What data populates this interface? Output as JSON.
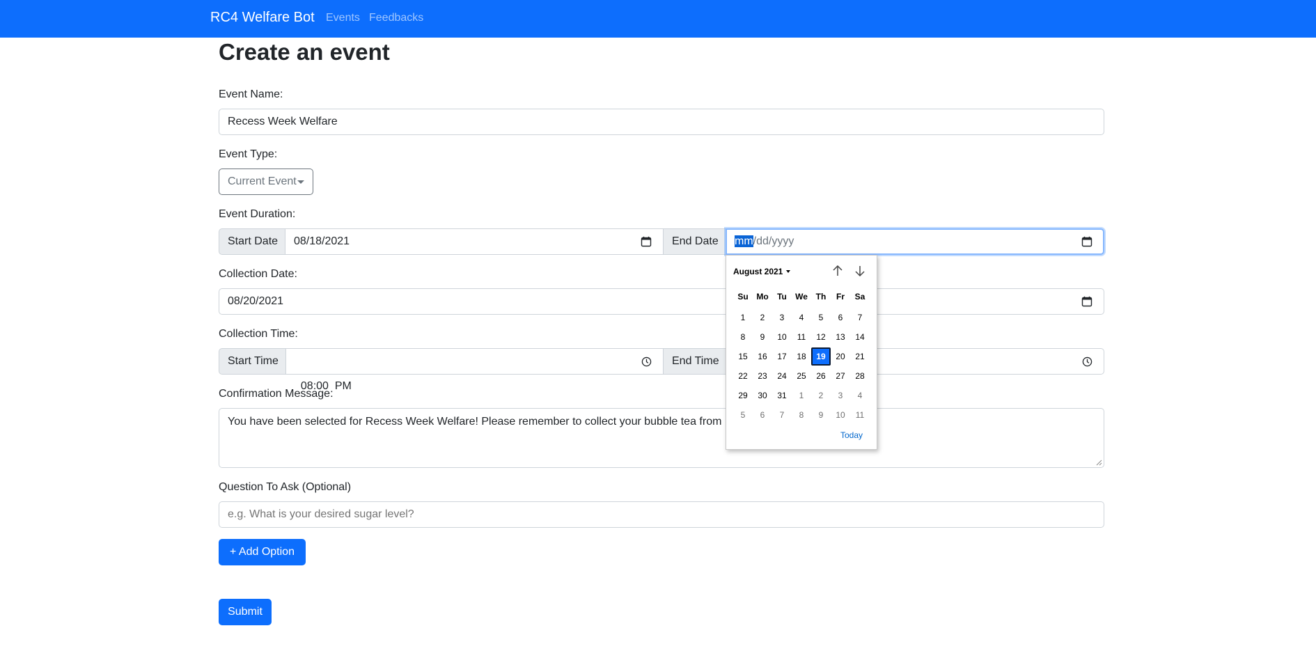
{
  "navbar": {
    "brand": "RC4 Welfare Bot",
    "links": [
      {
        "label": "Events"
      },
      {
        "label": "Feedbacks"
      }
    ]
  },
  "page_title": "Create an event",
  "form": {
    "event_name_label": "Event Name:",
    "event_name_value": "Recess Week Welfare",
    "event_type_label": "Event Type:",
    "event_type_value": "Current Event",
    "event_duration_label": "Event Duration:",
    "start_date_label": "Start Date",
    "start_date_value": "08/18/2021",
    "end_date_label": "End Date",
    "end_date_placeholder_mm": "mm",
    "end_date_placeholder_rest": "/dd/yyyy",
    "collection_date_label": "Collection Date:",
    "collection_date_value": "08/20/2021",
    "collection_time_label": "Collection Time:",
    "start_time_label": "Start Time",
    "start_time_value": "08:00  PM",
    "end_time_label": "End Time",
    "confirmation_label": "Confirmation Message:",
    "confirmation_value": "You have been selected for Recess Week Welfare! Please remember to collect your bubble tea from L8",
    "question_label": "Question To Ask (Optional)",
    "question_placeholder": "e.g. What is your desired sugar level?",
    "add_option_label": "+ Add Option",
    "submit_label": "Submit"
  },
  "datepicker": {
    "month_label": "August 2021",
    "weekdays": [
      "Su",
      "Mo",
      "Tu",
      "We",
      "Th",
      "Fr",
      "Sa"
    ],
    "weeks": [
      [
        {
          "d": "1"
        },
        {
          "d": "2"
        },
        {
          "d": "3"
        },
        {
          "d": "4"
        },
        {
          "d": "5"
        },
        {
          "d": "6"
        },
        {
          "d": "7"
        }
      ],
      [
        {
          "d": "8"
        },
        {
          "d": "9"
        },
        {
          "d": "10"
        },
        {
          "d": "11"
        },
        {
          "d": "12"
        },
        {
          "d": "13"
        },
        {
          "d": "14"
        }
      ],
      [
        {
          "d": "15"
        },
        {
          "d": "16"
        },
        {
          "d": "17"
        },
        {
          "d": "18"
        },
        {
          "d": "19",
          "selected": true
        },
        {
          "d": "20"
        },
        {
          "d": "21"
        }
      ],
      [
        {
          "d": "22"
        },
        {
          "d": "23"
        },
        {
          "d": "24"
        },
        {
          "d": "25"
        },
        {
          "d": "26"
        },
        {
          "d": "27"
        },
        {
          "d": "28"
        }
      ],
      [
        {
          "d": "29"
        },
        {
          "d": "30"
        },
        {
          "d": "31"
        },
        {
          "d": "1",
          "muted": true
        },
        {
          "d": "2",
          "muted": true
        },
        {
          "d": "3",
          "muted": true
        },
        {
          "d": "4",
          "muted": true
        }
      ],
      [
        {
          "d": "5",
          "muted": true
        },
        {
          "d": "6",
          "muted": true
        },
        {
          "d": "7",
          "muted": true
        },
        {
          "d": "8",
          "muted": true
        },
        {
          "d": "9",
          "muted": true
        },
        {
          "d": "10",
          "muted": true
        },
        {
          "d": "11",
          "muted": true
        }
      ]
    ],
    "today_label": "Today"
  },
  "colors": {
    "primary": "#0d6efd",
    "selected_day": "#0d6efd",
    "input_border": "#ced4da",
    "focus_border": "#86b7fe"
  }
}
